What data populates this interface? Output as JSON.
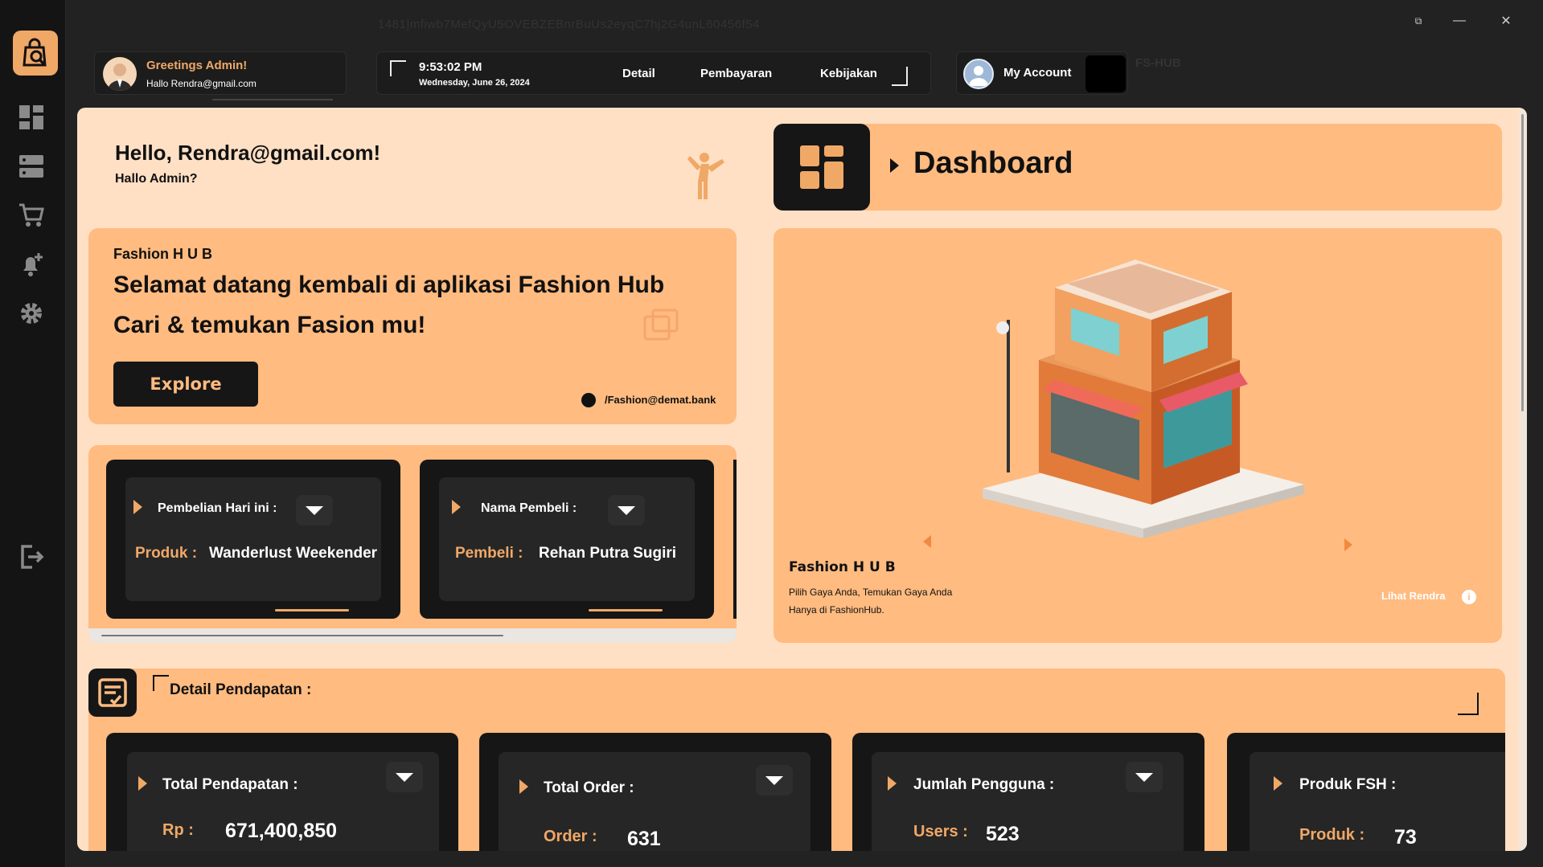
{
  "window": {
    "title": "1481|mfiwb7MefQyU5OVEBZEBnrBuUs2eyqC7hj2G4unL60456f54",
    "brand_tag": "FS-HUB"
  },
  "header": {
    "greeting_title": "Greetings Admin!",
    "greeting_sub": "Hallo Rendra@gmail.com",
    "time": "9:53:02 PM",
    "date": "Wednesday, June 26, 2024",
    "nav": [
      "Detail",
      "Pembayaran",
      "Kebijakan"
    ],
    "account_label": "My Account"
  },
  "hello": {
    "title": "Hello, Rendra@gmail.com!",
    "subtitle": "Hallo Admin?"
  },
  "dashboard_title": "Dashboard",
  "welcome": {
    "brand": "Fashion H U B",
    "line1": "Selamat datang kembali di aplikasi Fashion Hub",
    "line2": "Cari & temukan Fasion mu!",
    "button": "Explore",
    "handle": "/Fashion@demat.bank"
  },
  "mini_cards": [
    {
      "title": "Pembelian Hari ini  :",
      "label": "Produk :",
      "value": "Wanderlust Weekender"
    },
    {
      "title": "Nama Pembeli  :",
      "label": "Pembeli :",
      "value": "Rehan Putra Sugiri"
    }
  ],
  "showcase": {
    "brand": "Fashion H U B",
    "line1": "Pilih Gaya Anda, Temukan Gaya Anda",
    "line2": "Hanya di FashionHub.",
    "link": "Lihat Rendra"
  },
  "detail": {
    "title": "Detail Pendapatan :",
    "stats": [
      {
        "title": "Total Pendapatan :",
        "label": "Rp :",
        "value": "671,400,850"
      },
      {
        "title": "Total Order :",
        "label": "Order :",
        "value": "631"
      },
      {
        "title": "Jumlah Pengguna :",
        "label": "Users :",
        "value": "523"
      },
      {
        "title": "Produk FSH :",
        "label": "Produk :",
        "value": "73"
      }
    ]
  },
  "colors": {
    "accent": "#f0a867",
    "card": "#ffbb80",
    "bg": "#ffe0c4",
    "dark": "#161616"
  }
}
